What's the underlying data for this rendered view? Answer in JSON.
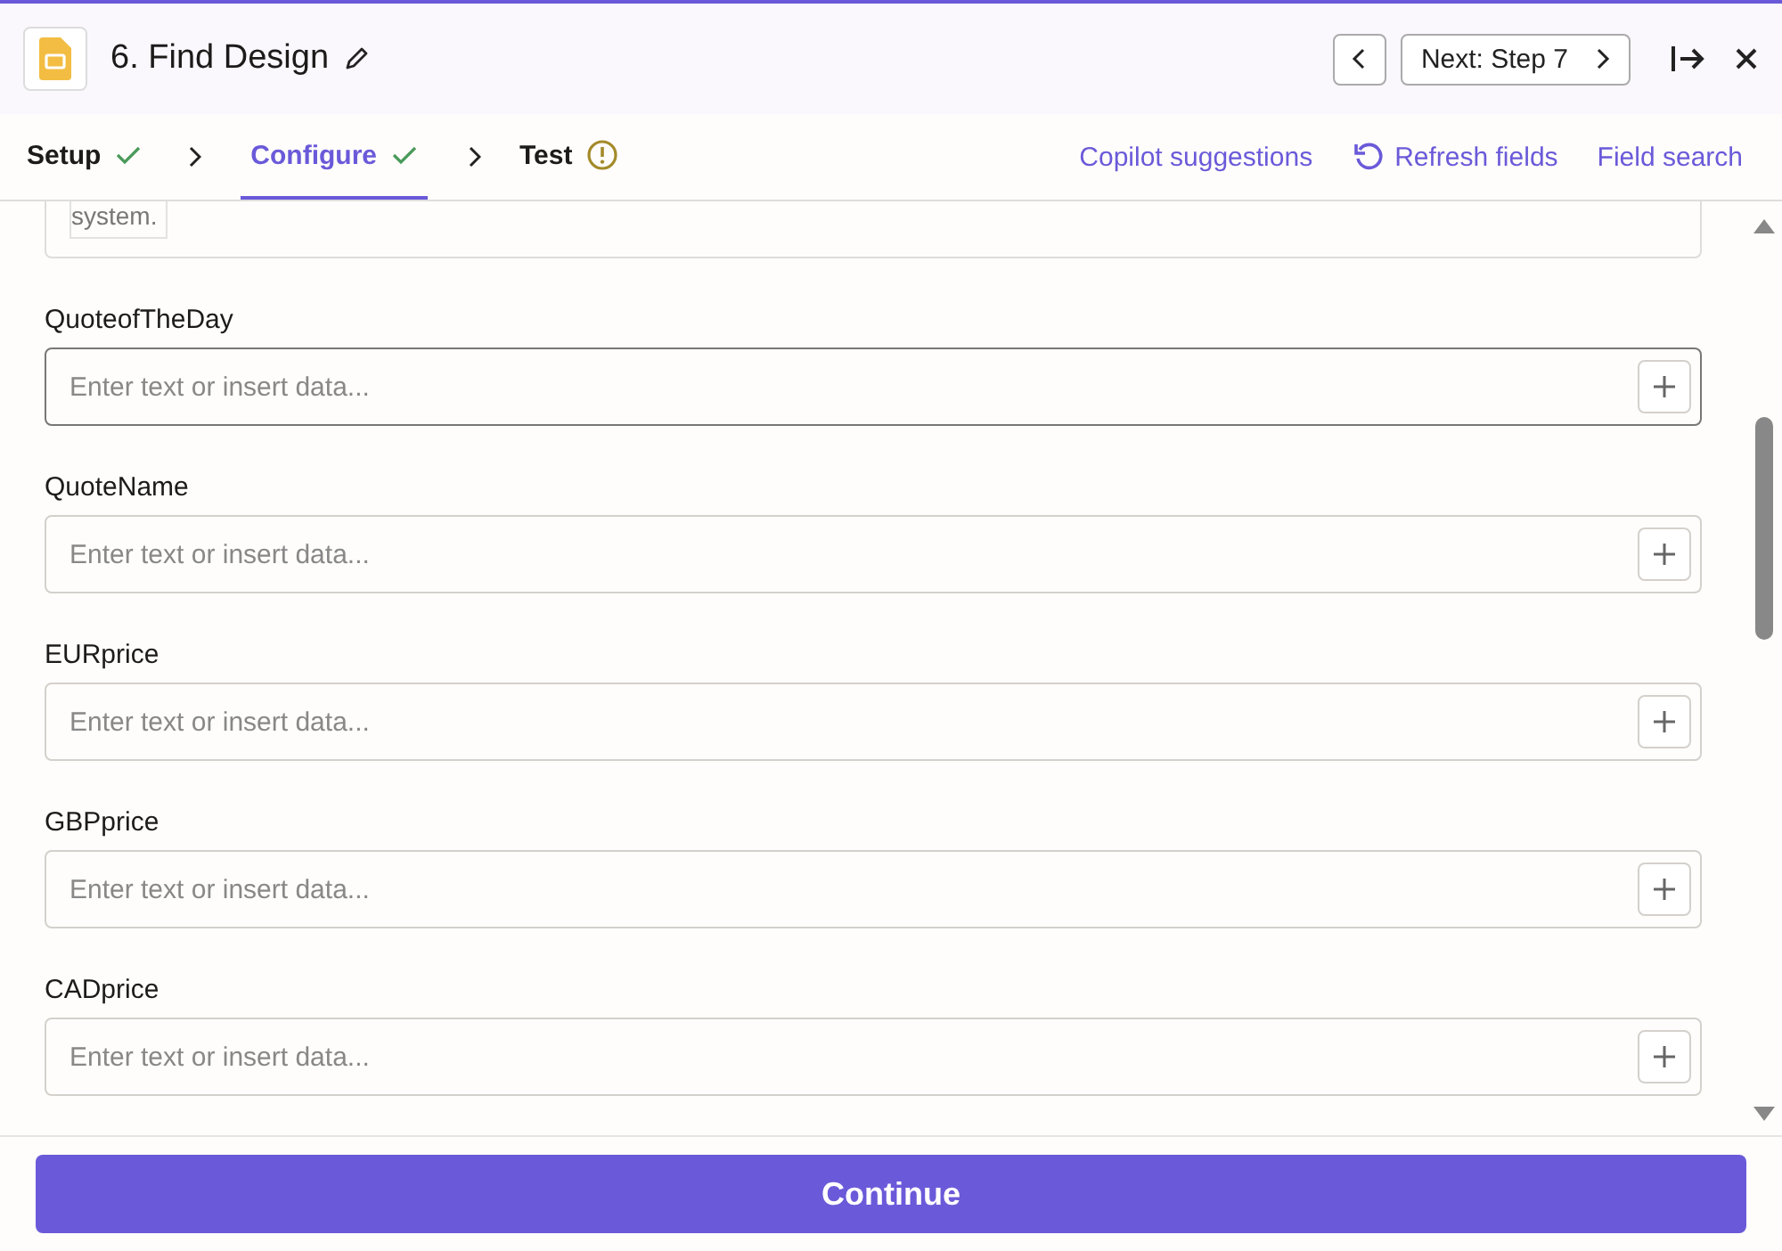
{
  "header": {
    "title": "6. Find Design",
    "next_label": "Next: Step 7"
  },
  "tabs": [
    {
      "label": "Setup",
      "selected": false,
      "kind": "check"
    },
    {
      "label": "Configure",
      "selected": true,
      "kind": "check"
    },
    {
      "label": "Test",
      "selected": false,
      "kind": "warning"
    }
  ],
  "actions": [
    {
      "label": "Copilot suggestions",
      "kind": "plain"
    },
    {
      "label": "Refresh fields",
      "kind": "refresh"
    },
    {
      "label": "Field search",
      "kind": "plain"
    }
  ],
  "partial_field": {
    "chip": "system."
  },
  "fields": [
    {
      "label": "QuoteofTheDay",
      "placeholder": "Enter text or insert data...",
      "focused": true
    },
    {
      "label": "QuoteName",
      "placeholder": "Enter text or insert data...",
      "focused": false
    },
    {
      "label": "EURprice",
      "placeholder": "Enter text or insert data...",
      "focused": false
    },
    {
      "label": "GBPprice",
      "placeholder": "Enter text or insert data...",
      "focused": false
    },
    {
      "label": "CADprice",
      "placeholder": "Enter text or insert data...",
      "focused": false
    }
  ],
  "footer": {
    "button": "Continue"
  }
}
